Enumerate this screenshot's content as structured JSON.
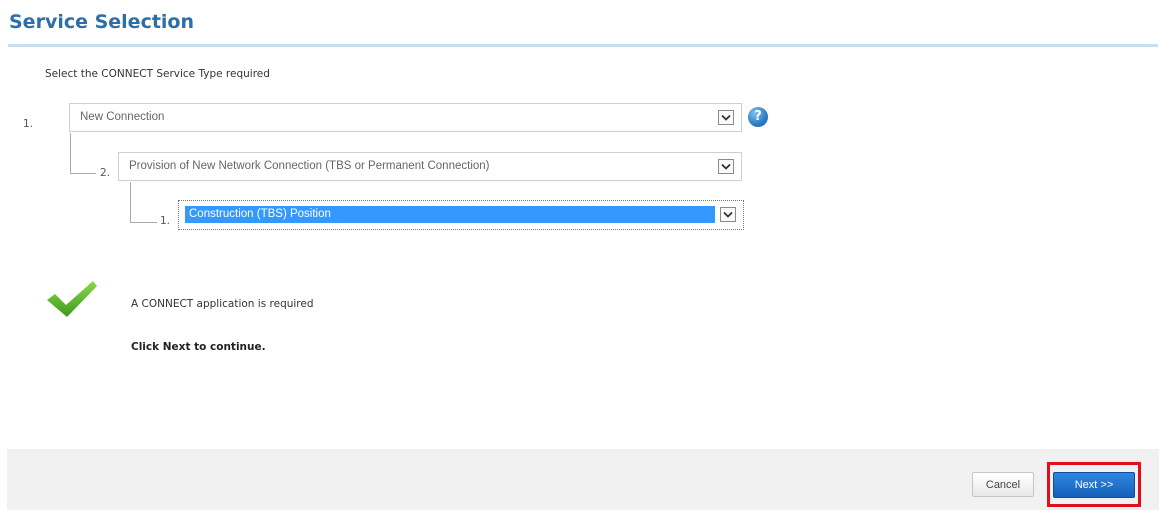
{
  "page": {
    "title": "Service Selection",
    "instruction": "Select the CONNECT Service Type required"
  },
  "selects": [
    {
      "number": "1.",
      "value": "New Connection"
    },
    {
      "number": "2.",
      "value": "Provision of New Network Connection (TBS or Permanent Connection)"
    },
    {
      "number": "1.",
      "value": "Construction (TBS) Position"
    }
  ],
  "result": {
    "message": "A CONNECT application is required",
    "call_to_action": "Click Next to continue."
  },
  "buttons": {
    "cancel_label": "Cancel",
    "next_label": "Next >>"
  },
  "icons": {
    "help": "question-mark",
    "help_glyph": "?",
    "status": "checkmark",
    "dropdown": "chevron-down"
  },
  "colors": {
    "title": "#2b6ea8",
    "accent_blue": "#1660b8",
    "selection_highlight": "#3399ff",
    "check_green": "#5fb82a",
    "annotation_red": "#e0101a"
  }
}
